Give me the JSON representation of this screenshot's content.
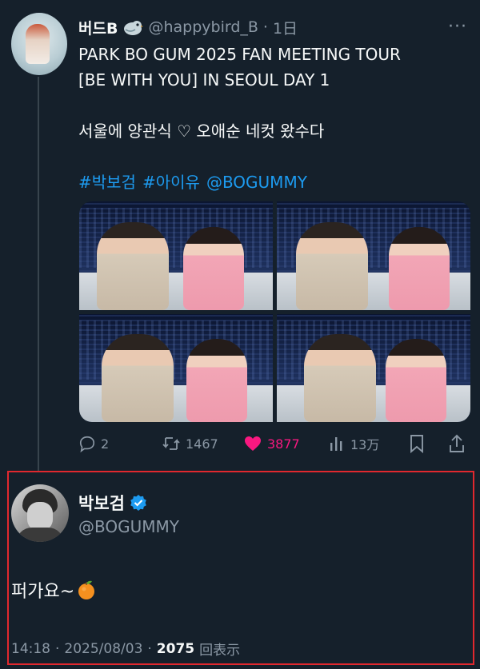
{
  "tweet": {
    "display_name": "버드B",
    "handle": "@happybird_B",
    "separator": "·",
    "time": "1日",
    "lines": [
      "PARK BO GUM 2025 FAN MEETING TOUR",
      "[BE WITH YOU] IN SEOUL DAY 1",
      "서울에 양관식 ♡ 오애순 네컷 왔수다"
    ],
    "hashtags": [
      "#박보검",
      "#아이유",
      "@BOGUMMY"
    ],
    "stats": {
      "replies": "2",
      "retweets": "1467",
      "likes": "3877",
      "views": "13万"
    },
    "icons": {
      "avatar": "profile-avatar",
      "badge": "bird-icon",
      "more": "more-icon",
      "reply": "reply-icon",
      "retweet": "retweet-icon",
      "like": "heart-icon",
      "views": "analytics-icon",
      "bookmark": "bookmark-icon",
      "share": "share-icon"
    }
  },
  "reply": {
    "display_name": "박보검",
    "handle": "@BOGUMMY",
    "text": "퍼가요~",
    "emoji": "orange-emoji",
    "time": "14:18",
    "date": "2025/08/03",
    "dot": "·",
    "view_count": "2075",
    "view_label": "回表示"
  },
  "colors": {
    "background": "#15202b",
    "text": "#f7f9f9",
    "muted": "#8b98a5",
    "link": "#1d9bf0",
    "like": "#f91880",
    "verified": "#1d9bf0",
    "highlight_border": "#e0282e"
  }
}
